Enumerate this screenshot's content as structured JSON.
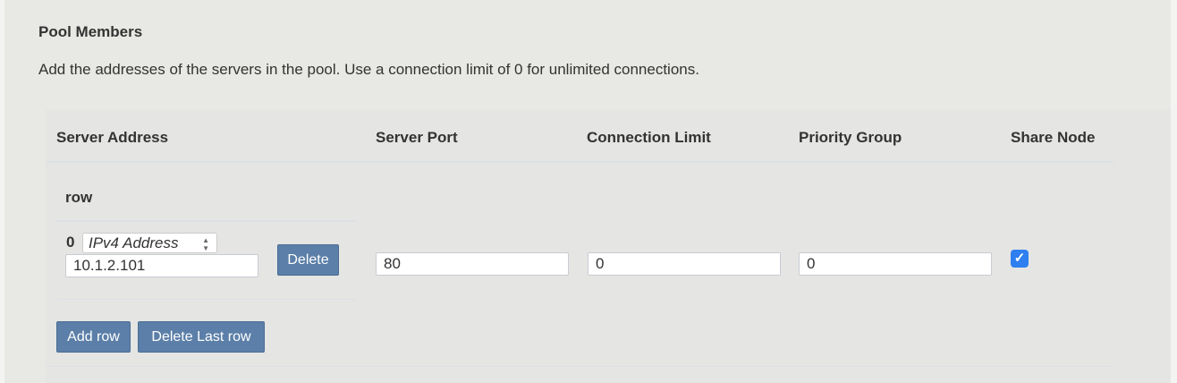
{
  "section": {
    "title": "Pool Members",
    "description": "Add the addresses of the servers in the pool. Use a connection limit of 0 for unlimited connections."
  },
  "columns": [
    "Server Address",
    "Server Port",
    "Connection Limit",
    "Priority Group",
    "Share Node"
  ],
  "row_header": "row",
  "rows": [
    {
      "index": "0",
      "address_type": "IPv4 Address",
      "address": "10.1.2.101",
      "delete_label": "Delete",
      "port": "80",
      "connection_limit": "0",
      "priority_group": "0",
      "share_node": true
    }
  ],
  "buttons": {
    "add_row": "Add row",
    "delete_last_row": "Delete Last row"
  },
  "colors": {
    "button": "#5b7fa8",
    "checkbox": "#2f7ff0"
  }
}
